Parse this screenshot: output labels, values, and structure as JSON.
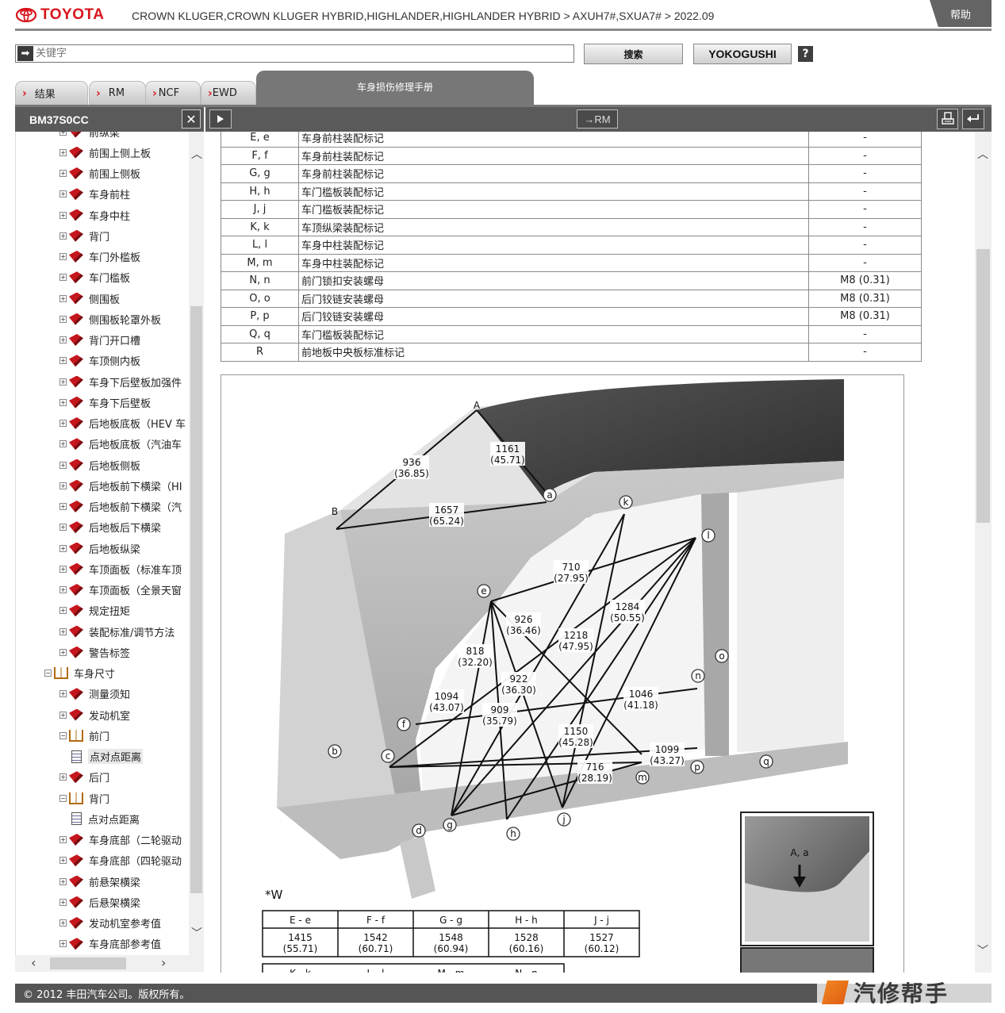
{
  "header": {
    "brand": "TOYOTA",
    "breadcrumb": "CROWN KLUGER,CROWN KLUGER HYBRID,HIGHLANDER,HIGHLANDER HYBRID > AXUH7#,SXUA7# > 2022.09",
    "help": "帮助"
  },
  "search": {
    "placeholder": "关键字",
    "search_btn": "搜索",
    "yokogushi_btn": "YOKOGUSHI",
    "help_q": "?"
  },
  "tabs": [
    {
      "label": "结果"
    },
    {
      "label": "RM"
    },
    {
      "label": "NCF"
    },
    {
      "label": "EWD"
    }
  ],
  "active_tab": "车身损伤修理手册",
  "toolbar": {
    "doc_id": "BM37S0CC",
    "close": "✕",
    "rm_btn": "→RM"
  },
  "tree": [
    {
      "label": "前纵梁",
      "type": "book",
      "indent": 1
    },
    {
      "label": "前围上侧上板",
      "type": "book",
      "indent": 1
    },
    {
      "label": "前围上侧板",
      "type": "book",
      "indent": 1
    },
    {
      "label": "车身前柱",
      "type": "book",
      "indent": 1
    },
    {
      "label": "车身中柱",
      "type": "book",
      "indent": 1
    },
    {
      "label": "背门",
      "type": "book",
      "indent": 1
    },
    {
      "label": "车门外槛板",
      "type": "book",
      "indent": 1
    },
    {
      "label": "车门槛板",
      "type": "book",
      "indent": 1
    },
    {
      "label": "侧围板",
      "type": "book",
      "indent": 1
    },
    {
      "label": "侧围板轮罩外板",
      "type": "book",
      "indent": 1
    },
    {
      "label": "背门开口槽",
      "type": "book",
      "indent": 1
    },
    {
      "label": "车顶侧内板",
      "type": "book",
      "indent": 1
    },
    {
      "label": "车身下后壁板加强件",
      "type": "book",
      "indent": 1
    },
    {
      "label": "车身下后壁板",
      "type": "book",
      "indent": 1
    },
    {
      "label": "后地板底板（HEV 车",
      "type": "book",
      "indent": 1
    },
    {
      "label": "后地板底板（汽油车",
      "type": "book",
      "indent": 1
    },
    {
      "label": "后地板侧板",
      "type": "book",
      "indent": 1
    },
    {
      "label": "后地板前下横梁（HI",
      "type": "book",
      "indent": 1
    },
    {
      "label": "后地板前下横梁（汽",
      "type": "book",
      "indent": 1
    },
    {
      "label": "后地板后下横梁",
      "type": "book",
      "indent": 1
    },
    {
      "label": "后地板纵梁",
      "type": "book",
      "indent": 1
    },
    {
      "label": "车顶面板（标准车顶",
      "type": "book",
      "indent": 1
    },
    {
      "label": "车顶面板（全景天窗",
      "type": "book",
      "indent": 1
    },
    {
      "label": "规定扭矩",
      "type": "book",
      "indent": 1
    },
    {
      "label": "装配标准/调节方法",
      "type": "book",
      "indent": 1
    },
    {
      "label": "警告标签",
      "type": "book",
      "indent": 1
    },
    {
      "label": "车身尺寸",
      "type": "open",
      "indent": 0
    },
    {
      "label": "测量须知",
      "type": "book",
      "indent": 1
    },
    {
      "label": "发动机室",
      "type": "book",
      "indent": 1
    },
    {
      "label": "前门",
      "type": "open",
      "indent": 1
    },
    {
      "label": "点对点距离",
      "type": "doc",
      "indent": 2,
      "selected": true
    },
    {
      "label": "后门",
      "type": "book",
      "indent": 1
    },
    {
      "label": "背门",
      "type": "open",
      "indent": 1
    },
    {
      "label": "点对点距离",
      "type": "doc",
      "indent": 2
    },
    {
      "label": "车身底部（二轮驱动",
      "type": "book",
      "indent": 1
    },
    {
      "label": "车身底部（四轮驱动",
      "type": "book",
      "indent": 1
    },
    {
      "label": "前悬架横梁",
      "type": "book",
      "indent": 1
    },
    {
      "label": "后悬架横梁",
      "type": "book",
      "indent": 1
    },
    {
      "label": "发动机室参考值",
      "type": "book",
      "indent": 1
    },
    {
      "label": "车身底部参考值",
      "type": "book",
      "indent": 1
    }
  ],
  "parts_table": [
    [
      "E, e",
      "车身前柱装配标记",
      "-"
    ],
    [
      "F, f",
      "车身前柱装配标记",
      "-"
    ],
    [
      "G, g",
      "车身前柱装配标记",
      "-"
    ],
    [
      "H, h",
      "车门槛板装配标记",
      "-"
    ],
    [
      "J, j",
      "车门槛板装配标记",
      "-"
    ],
    [
      "K, k",
      "车顶纵梁装配标记",
      "-"
    ],
    [
      "L, l",
      "车身中柱装配标记",
      "-"
    ],
    [
      "M, m",
      "车身中柱装配标记",
      "-"
    ],
    [
      "N, n",
      "前门锁扣安装螺母",
      "M8 (0.31)"
    ],
    [
      "O, o",
      "后门铰链安装螺母",
      "M8 (0.31)"
    ],
    [
      "P, p",
      "后门铰链安装螺母",
      "M8 (0.31)"
    ],
    [
      "Q, q",
      "车门槛板装配标记",
      "-"
    ],
    [
      "R",
      "前地板中央板标准标记",
      "-"
    ]
  ],
  "diagram": {
    "dims": [
      {
        "mm": "1161",
        "in": "(45.71)"
      },
      {
        "mm": "936",
        "in": "(36.85)"
      },
      {
        "mm": "1657",
        "in": "(65.24)"
      },
      {
        "mm": "710",
        "in": "(27.95)"
      },
      {
        "mm": "1284",
        "in": "(50.55)"
      },
      {
        "mm": "926",
        "in": "(36.46)"
      },
      {
        "mm": "1218",
        "in": "(47.95)"
      },
      {
        "mm": "818",
        "in": "(32.20)"
      },
      {
        "mm": "922",
        "in": "(36.30)"
      },
      {
        "mm": "1046",
        "in": "(41.18)"
      },
      {
        "mm": "1094",
        "in": "(43.07)"
      },
      {
        "mm": "909",
        "in": "(35.79)"
      },
      {
        "mm": "1150",
        "in": "(45.28)"
      },
      {
        "mm": "1099",
        "in": "(43.27)"
      },
      {
        "mm": "716",
        "in": "(28.19)"
      }
    ],
    "points": [
      "A",
      "B",
      "a",
      "k",
      "l",
      "e",
      "o",
      "n",
      "f",
      "b",
      "c",
      "p",
      "m",
      "q",
      "d",
      "g",
      "h",
      "j"
    ],
    "inset_label": "A, a",
    "w_label": "*W",
    "w_table": {
      "headers": [
        "E - e",
        "F - f",
        "G - g",
        "H - h",
        "J - j"
      ],
      "mm": [
        "1415",
        "1542",
        "1548",
        "1528",
        "1527"
      ],
      "in": [
        "(55.71)",
        "(60.71)",
        "(60.94)",
        "(60.16)",
        "(60.12)"
      ],
      "next_headers": [
        "K - k",
        "L - l",
        "M - m",
        "N - n"
      ]
    }
  },
  "footer": "© 2012 丰田汽车公司。版权所有。",
  "watermark": "汽修帮手"
}
